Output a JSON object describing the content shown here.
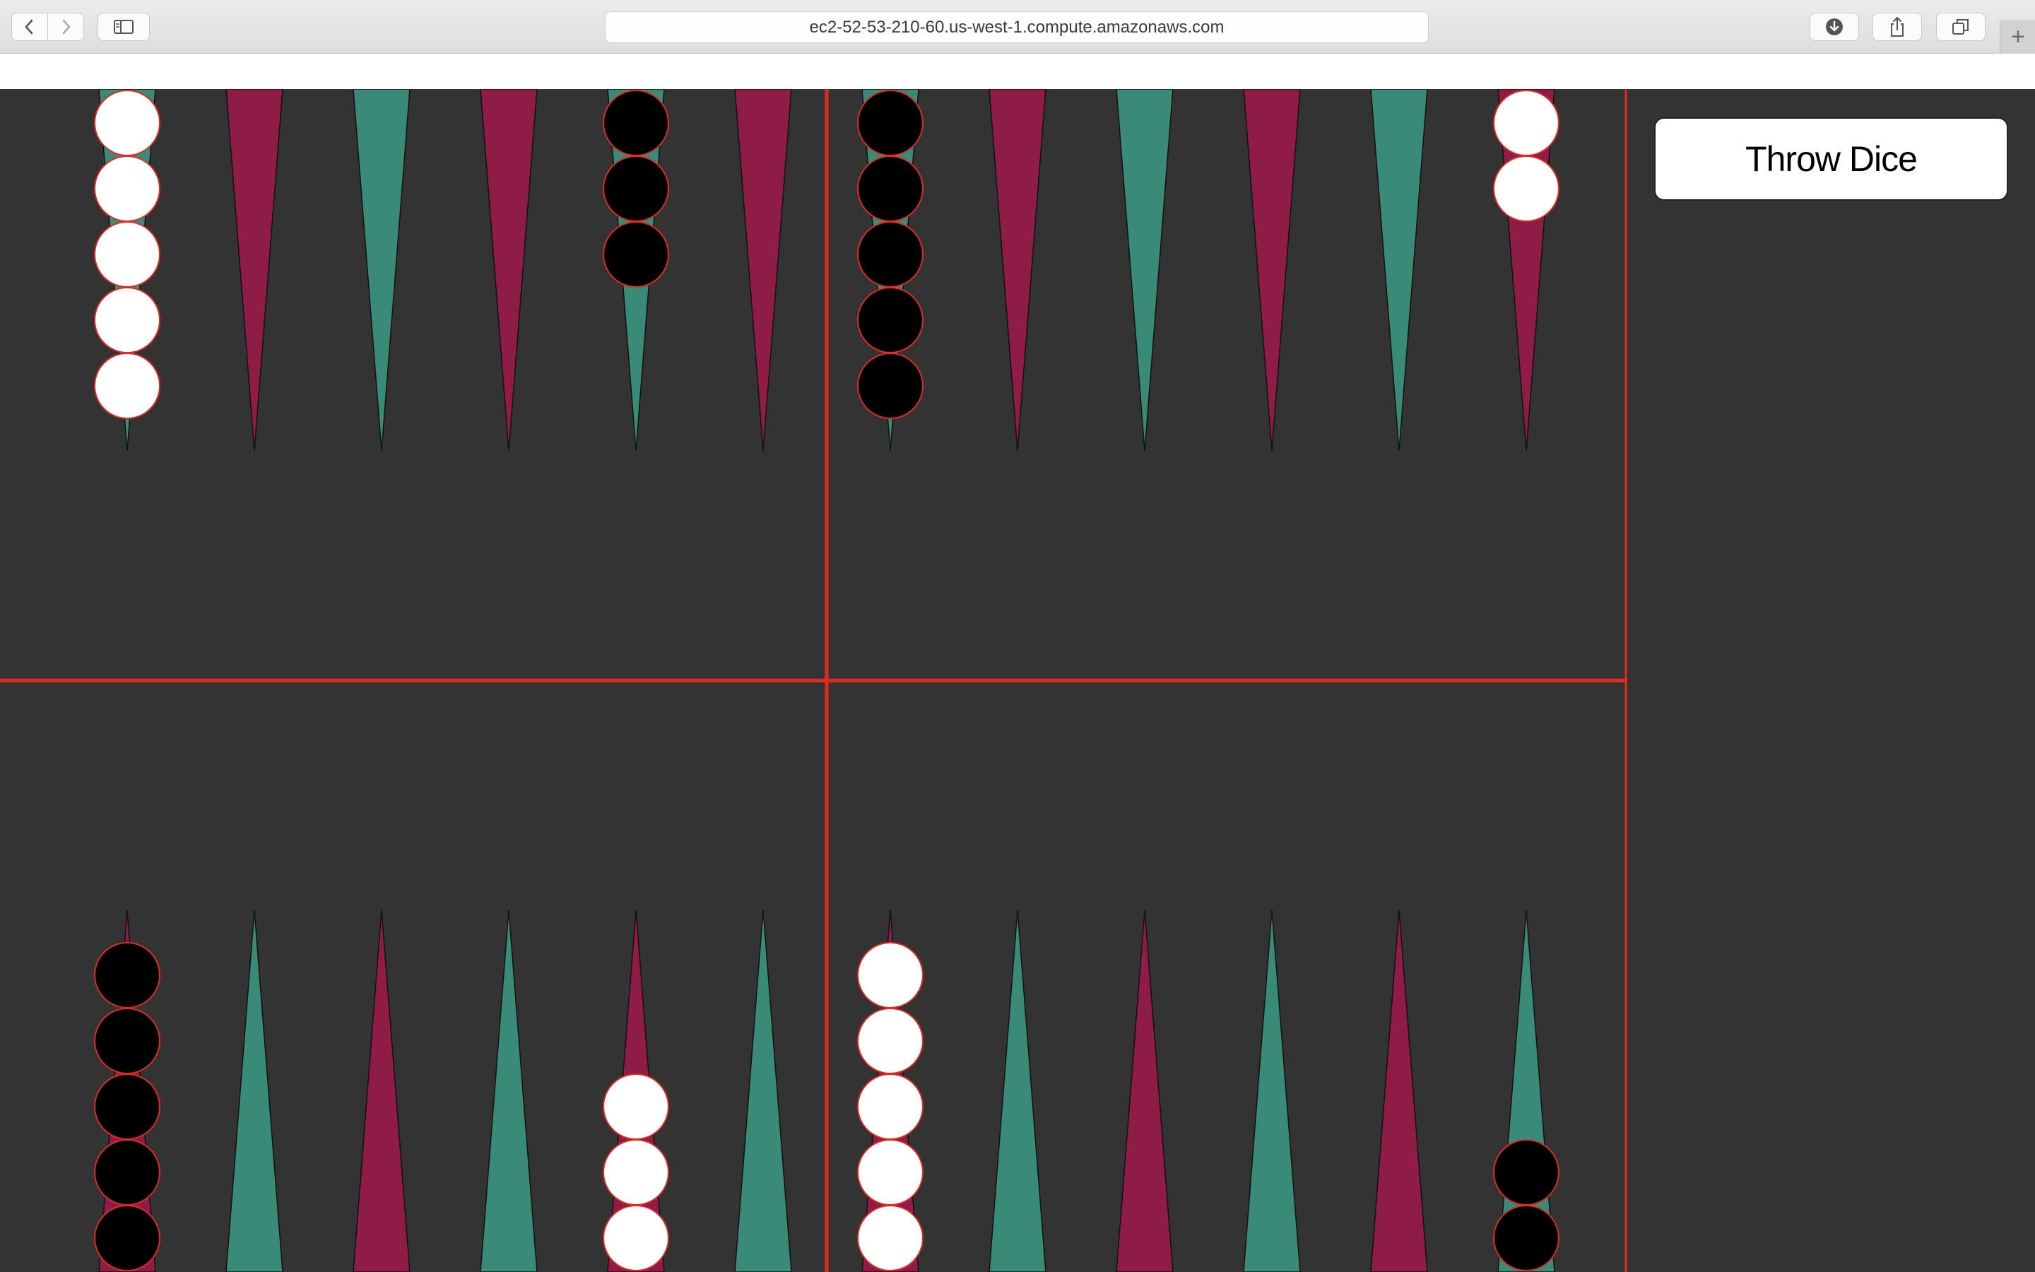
{
  "browser": {
    "url": "ec2-52-53-210-60.us-west-1.compute.amazonaws.com",
    "new_tab_label": "+"
  },
  "panel": {
    "throw_dice_label": "Throw Dice"
  },
  "colors": {
    "board_background": "#333333",
    "point_teal": "#3a8a78",
    "point_maroon": "#8f1c47",
    "divider_red": "#e02a22",
    "checker_white": "#ffffff",
    "checker_black": "#000000",
    "checker_outline": "#e02a22"
  },
  "board": {
    "top_points": [
      {
        "color": "teal",
        "checkers": {
          "color": "white",
          "count": 5
        }
      },
      {
        "color": "maroon",
        "checkers": null
      },
      {
        "color": "teal",
        "checkers": null
      },
      {
        "color": "maroon",
        "checkers": null
      },
      {
        "color": "teal",
        "checkers": {
          "color": "black",
          "count": 3
        }
      },
      {
        "color": "maroon",
        "checkers": null
      },
      {
        "color": "teal",
        "checkers": {
          "color": "black",
          "count": 5
        }
      },
      {
        "color": "maroon",
        "checkers": null
      },
      {
        "color": "teal",
        "checkers": null
      },
      {
        "color": "maroon",
        "checkers": null
      },
      {
        "color": "teal",
        "checkers": null
      },
      {
        "color": "maroon",
        "checkers": {
          "color": "white",
          "count": 2
        }
      }
    ],
    "bottom_points": [
      {
        "color": "maroon",
        "checkers": {
          "color": "black",
          "count": 5
        }
      },
      {
        "color": "teal",
        "checkers": null
      },
      {
        "color": "maroon",
        "checkers": null
      },
      {
        "color": "teal",
        "checkers": null
      },
      {
        "color": "maroon",
        "checkers": {
          "color": "white",
          "count": 3
        }
      },
      {
        "color": "teal",
        "checkers": null
      },
      {
        "color": "maroon",
        "checkers": {
          "color": "white",
          "count": 5
        }
      },
      {
        "color": "teal",
        "checkers": null
      },
      {
        "color": "maroon",
        "checkers": null
      },
      {
        "color": "teal",
        "checkers": null
      },
      {
        "color": "maroon",
        "checkers": null
      },
      {
        "color": "teal",
        "checkers": {
          "color": "black",
          "count": 2
        }
      }
    ]
  }
}
